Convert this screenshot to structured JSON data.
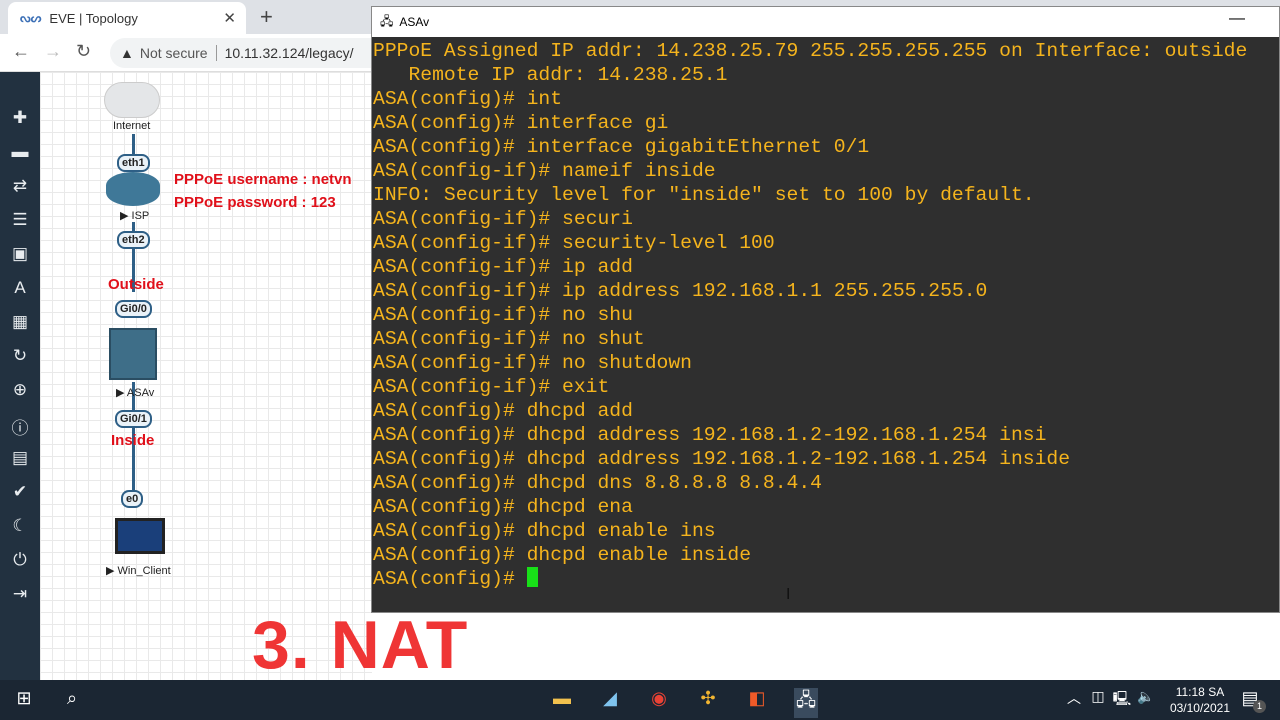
{
  "browser": {
    "tab_title": "EVE | Topology",
    "url": "10.11.32.124/legacy/",
    "security": "Not secure"
  },
  "topology": {
    "nodes": [
      "Internet",
      "ISP",
      "ASAv",
      "Win_Client"
    ],
    "ports": [
      "eth1",
      "eth2",
      "Gi0/0",
      "Gi0/1",
      "e0"
    ],
    "labels": {
      "outside": "Outside",
      "inside": "Inside",
      "username": "PPPoE username : netvn",
      "password": "PPPoE password : 123"
    }
  },
  "overlay_title": "3. NAT",
  "terminal": {
    "title": "ASAv",
    "lines": [
      "PPPoE Assigned IP addr: 14.238.25.79 255.255.255.255 on Interface: outside",
      "   Remote IP addr: 14.238.25.1",
      "ASA(config)# int",
      "ASA(config)# interface gi",
      "ASA(config)# interface gigabitEthernet 0/1",
      "ASA(config-if)# nameif inside",
      "INFO: Security level for \"inside\" set to 100 by default.",
      "ASA(config-if)# securi",
      "ASA(config-if)# security-level 100",
      "ASA(config-if)# ip add",
      "ASA(config-if)# ip address 192.168.1.1 255.255.255.0",
      "ASA(config-if)# no shu",
      "ASA(config-if)# no shut",
      "ASA(config-if)# no shutdown",
      "ASA(config-if)# exit",
      "ASA(config)# dhcpd add",
      "ASA(config)# dhcpd address 192.168.1.2-192.168.1.254 insi",
      "ASA(config)# dhcpd address 192.168.1.2-192.168.1.254 inside",
      "ASA(config)# dhcpd dns 8.8.8.8 8.8.4.4",
      "ASA(config)# dhcpd ena",
      "ASA(config)# dhcpd enable ins",
      "ASA(config)# dhcpd enable inside"
    ],
    "prompt": "ASA(config)# "
  },
  "taskbar": {
    "time": "11:18 SA",
    "date": "03/10/2021",
    "notifications": "1"
  }
}
